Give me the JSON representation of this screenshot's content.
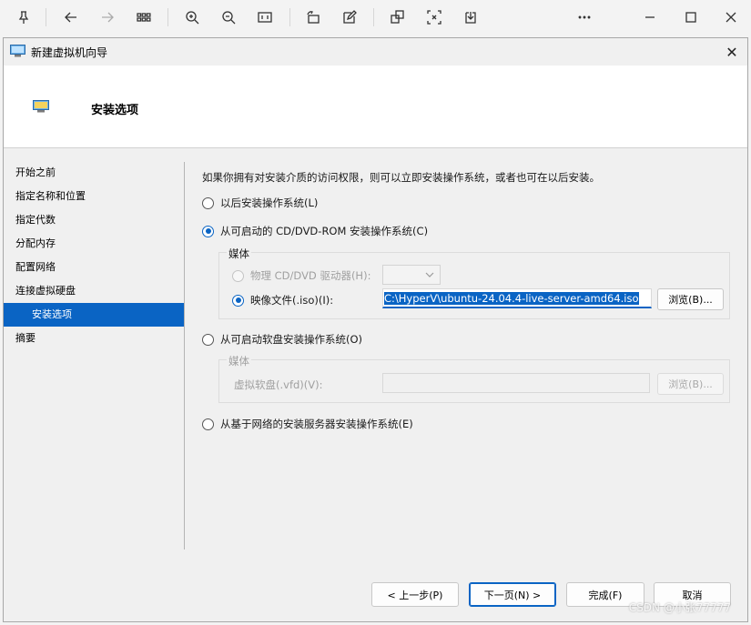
{
  "dialog": {
    "title": "新建虚拟机向导",
    "close_glyph": "✕",
    "header_title": "安装选项"
  },
  "nav": {
    "items": [
      {
        "label": "开始之前"
      },
      {
        "label": "指定名称和位置"
      },
      {
        "label": "指定代数"
      },
      {
        "label": "分配内存"
      },
      {
        "label": "配置网络"
      },
      {
        "label": "连接虚拟硬盘"
      },
      {
        "label": "安装选项",
        "selected": true
      },
      {
        "label": "摘要"
      }
    ]
  },
  "main": {
    "intro": "如果你拥有对安装介质的访问权限，则可以立即安装操作系统，或者也可在以后安装。",
    "option_later": "以后安装操作系统(L)",
    "option_cd": "从可启动的 CD/DVD-ROM 安装操作系统(C)",
    "cd_media_title": "媒体",
    "physical_drive_label": "物理 CD/DVD 驱动器(H):",
    "image_file_label": "映像文件(.iso)(I):",
    "image_file_value": "C:\\HyperV\\ubuntu-24.04.4-live-server-amd64.iso",
    "browse_iso": "浏览(B)...",
    "option_floppy": "从可启动软盘安装操作系统(O)",
    "floppy_media_title": "媒体",
    "floppy_label": "虚拟软盘(.vfd)(V):",
    "browse_floppy": "浏览(B)...",
    "option_network": "从基于网络的安装服务器安装操作系统(E)"
  },
  "footer": {
    "prev": "< 上一步(P)",
    "next": "下一页(N) >",
    "finish": "完成(F)",
    "cancel": "取消"
  },
  "watermark": "CSDN @小张77777",
  "colors": {
    "accent": "#0a64c4",
    "selection": "#0a64c4"
  }
}
